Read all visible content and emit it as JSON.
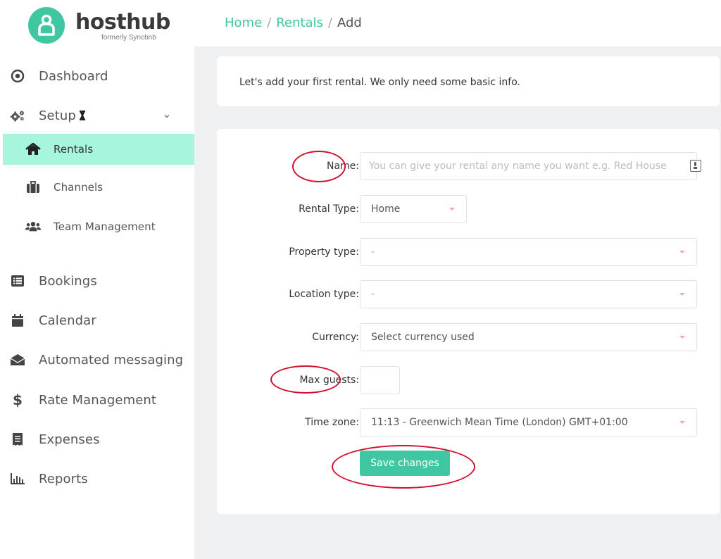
{
  "brand": {
    "name": "hosthub",
    "subtitle": "formerly Syncbnb",
    "accent": "#3ec7a0",
    "active_bg": "#a8f5de"
  },
  "breadcrumb": {
    "home": "Home",
    "rentals": "Rentals",
    "current": "Add",
    "separator": "/"
  },
  "sidebar": {
    "items": [
      {
        "id": "dashboard",
        "label": "Dashboard",
        "icon": "target-icon"
      },
      {
        "id": "setup",
        "label": "Setup",
        "icon": "gears-icon",
        "badge_icon": "hourglass-icon",
        "expanded": true
      },
      {
        "id": "rentals",
        "label": "Rentals",
        "icon": "home-icon",
        "active": true
      },
      {
        "id": "channels",
        "label": "Channels",
        "icon": "luggage-icon"
      },
      {
        "id": "team",
        "label": "Team Management",
        "icon": "users-icon"
      },
      {
        "id": "bookings",
        "label": "Bookings",
        "icon": "list-icon"
      },
      {
        "id": "calendar",
        "label": "Calendar",
        "icon": "calendar-icon"
      },
      {
        "id": "messaging",
        "label": "Automated messaging",
        "icon": "envelope-icon"
      },
      {
        "id": "rates",
        "label": "Rate Management",
        "icon": "dollar-icon"
      },
      {
        "id": "expenses",
        "label": "Expenses",
        "icon": "receipt-icon"
      },
      {
        "id": "reports",
        "label": "Reports",
        "icon": "bar-chart-icon"
      }
    ]
  },
  "intro": {
    "text": "Let's add your first rental. We only need some basic info."
  },
  "form": {
    "name_label": "Name:",
    "name_placeholder": "You can give your rental any name you want e.g. Red House",
    "name_value": "",
    "rental_type_label": "Rental Type:",
    "rental_type_value": "Home",
    "property_type_label": "Property type:",
    "property_type_value": "-",
    "location_type_label": "Location type:",
    "location_type_value": "-",
    "currency_label": "Currency:",
    "currency_value": "Select currency used",
    "max_guests_label": "Max guests:",
    "max_guests_value": "",
    "time_zone_label": "Time zone:",
    "time_zone_value": "11:13 - Greenwich Mean Time (London) GMT+01:00",
    "save_label": "Save changes"
  },
  "annotation_color": "#d0102c"
}
